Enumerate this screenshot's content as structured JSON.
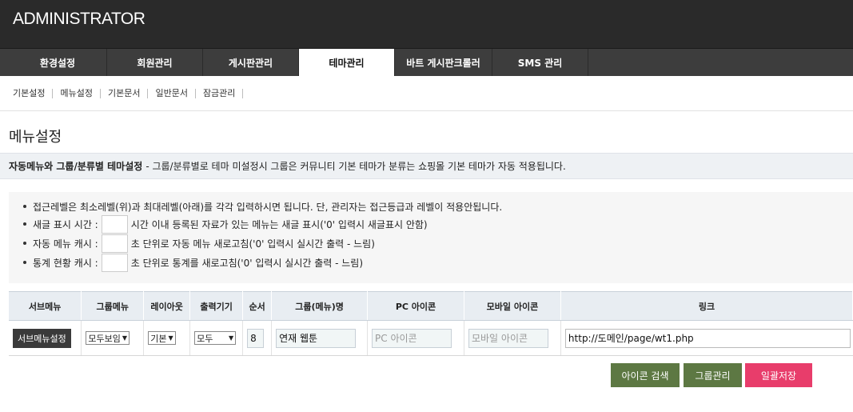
{
  "header": {
    "title": "ADMINISTRATOR"
  },
  "gnb": [
    "환경설정",
    "회원관리",
    "게시판관리",
    "테마관리",
    "바트 게시판크롤러",
    "SMS 관리"
  ],
  "snb": [
    "기본설정",
    "메뉴설정",
    "기본문서",
    "일반문서",
    "잠금관리"
  ],
  "page_title": "메뉴설정",
  "notice": {
    "strong": "자동메뉴와 그룹/분류별 테마설정",
    "text": "- 그룹/분류별로 테마 미설정시 그룹은 커뮤니티 기본 테마가 분류는 쇼핑몰 기본 테마가 자동 적용됩니다."
  },
  "info": {
    "line1": "접근레벨은 최소레벨(위)과 최대레벨(아래)를 각각 입력하시면 됩니다. 단, 관리자는 접근등급과 레벨이 적용안됩니다.",
    "line2_label": "새글 표시 시간 :",
    "line2_text": "시간 이내 등록된 자료가 있는 메뉴는 새글 표시('0' 입력시 새글표시 안함)",
    "line3_label": "자동 메뉴 캐시 :",
    "line3_text": "초 단위로 자동 메뉴 새로고침('0' 입력시 실시간 출력 - 느림)",
    "line4_label": "통계 현황 캐시 :",
    "line4_text": "초 단위로 통계를 새로고침('0' 입력시 실시간 출력 - 느림)"
  },
  "table": {
    "headers": [
      "서브메뉴",
      "그룹메뉴",
      "레이아웃",
      "출력기기",
      "순서",
      "그룹(메뉴)명",
      "PC 아이콘",
      "모바일 아이콘",
      "링크"
    ],
    "row": {
      "sub_button": "서브메뉴설정",
      "group_menu": "모두보임",
      "layout": "기본",
      "device": "모두",
      "order": "8",
      "name": "연재 웹툰",
      "pc_icon_placeholder": "PC 아이콘",
      "mobile_icon_placeholder": "모바일 아이콘",
      "link": "http://도메인/page/wt1.php"
    }
  },
  "buttons": {
    "icon_search": "아이콘 검색",
    "group_manage": "그룹관리",
    "save_all": "일괄저장"
  },
  "colors": {
    "header_bg": "#2a2a2a",
    "nav_bg": "#3d3d3d",
    "green": "#5d7843",
    "pink": "#e83d6b"
  }
}
